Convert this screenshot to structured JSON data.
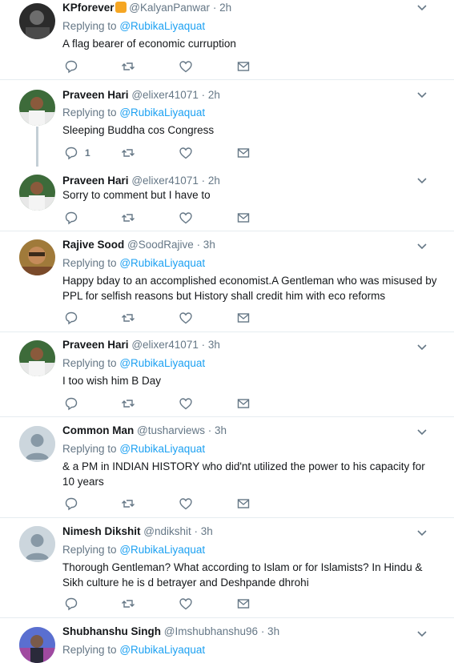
{
  "colors": {
    "link": "#1da1f2",
    "secondary": "#657786",
    "border": "#e6ecf0"
  },
  "replying_prefix": "Replying to",
  "tweets": [
    {
      "name": "KPforever",
      "handle": "@KalyanPanwar",
      "time": "· 2h",
      "reply_to": "@RubikaLiyaquat",
      "text": "A flag bearer of economic curruption",
      "reply_count": ""
    },
    {
      "name": "Praveen Hari",
      "handle": "@elixer41071",
      "time": "· 2h",
      "reply_to": "@RubikaLiyaquat",
      "text": "Sleeping Buddha cos Congress",
      "reply_count": "1"
    },
    {
      "name": "Praveen Hari",
      "handle": "@elixer41071",
      "time": "· 2h",
      "reply_to": "",
      "text": "Sorry to comment but I have to",
      "reply_count": ""
    },
    {
      "name": "Rajive Sood",
      "handle": "@SoodRajive",
      "time": "· 3h",
      "reply_to": "@RubikaLiyaquat",
      "text": "Happy bday to an accomplished economist.A Gentleman who was misused by PPL for selfish reasons but History shall credit him with eco reforms",
      "reply_count": ""
    },
    {
      "name": "Praveen Hari",
      "handle": "@elixer41071",
      "time": "· 3h",
      "reply_to": "@RubikaLiyaquat",
      "text": "I too wish him B Day",
      "reply_count": ""
    },
    {
      "name": "Common Man",
      "handle": "@tusharviews",
      "time": "· 3h",
      "reply_to": "@RubikaLiyaquat",
      "text": "& a PM in INDIAN HISTORY who did'nt utilized the power to his capacity for 10 years",
      "reply_count": ""
    },
    {
      "name": "Nimesh Dikshit",
      "handle": "@ndikshit",
      "time": "· 3h",
      "reply_to": "@RubikaLiyaquat",
      "text": "Thorough Gentleman? What according to Islam or for Islamists? In Hindu & Sikh culture he is d betrayer and Deshpande dhrohi",
      "reply_count": ""
    },
    {
      "name": "Shubhanshu Singh",
      "handle": "@Imshubhanshu96",
      "time": "· 3h",
      "reply_to": "@RubikaLiyaquat",
      "text": "",
      "reply_count": ""
    }
  ]
}
